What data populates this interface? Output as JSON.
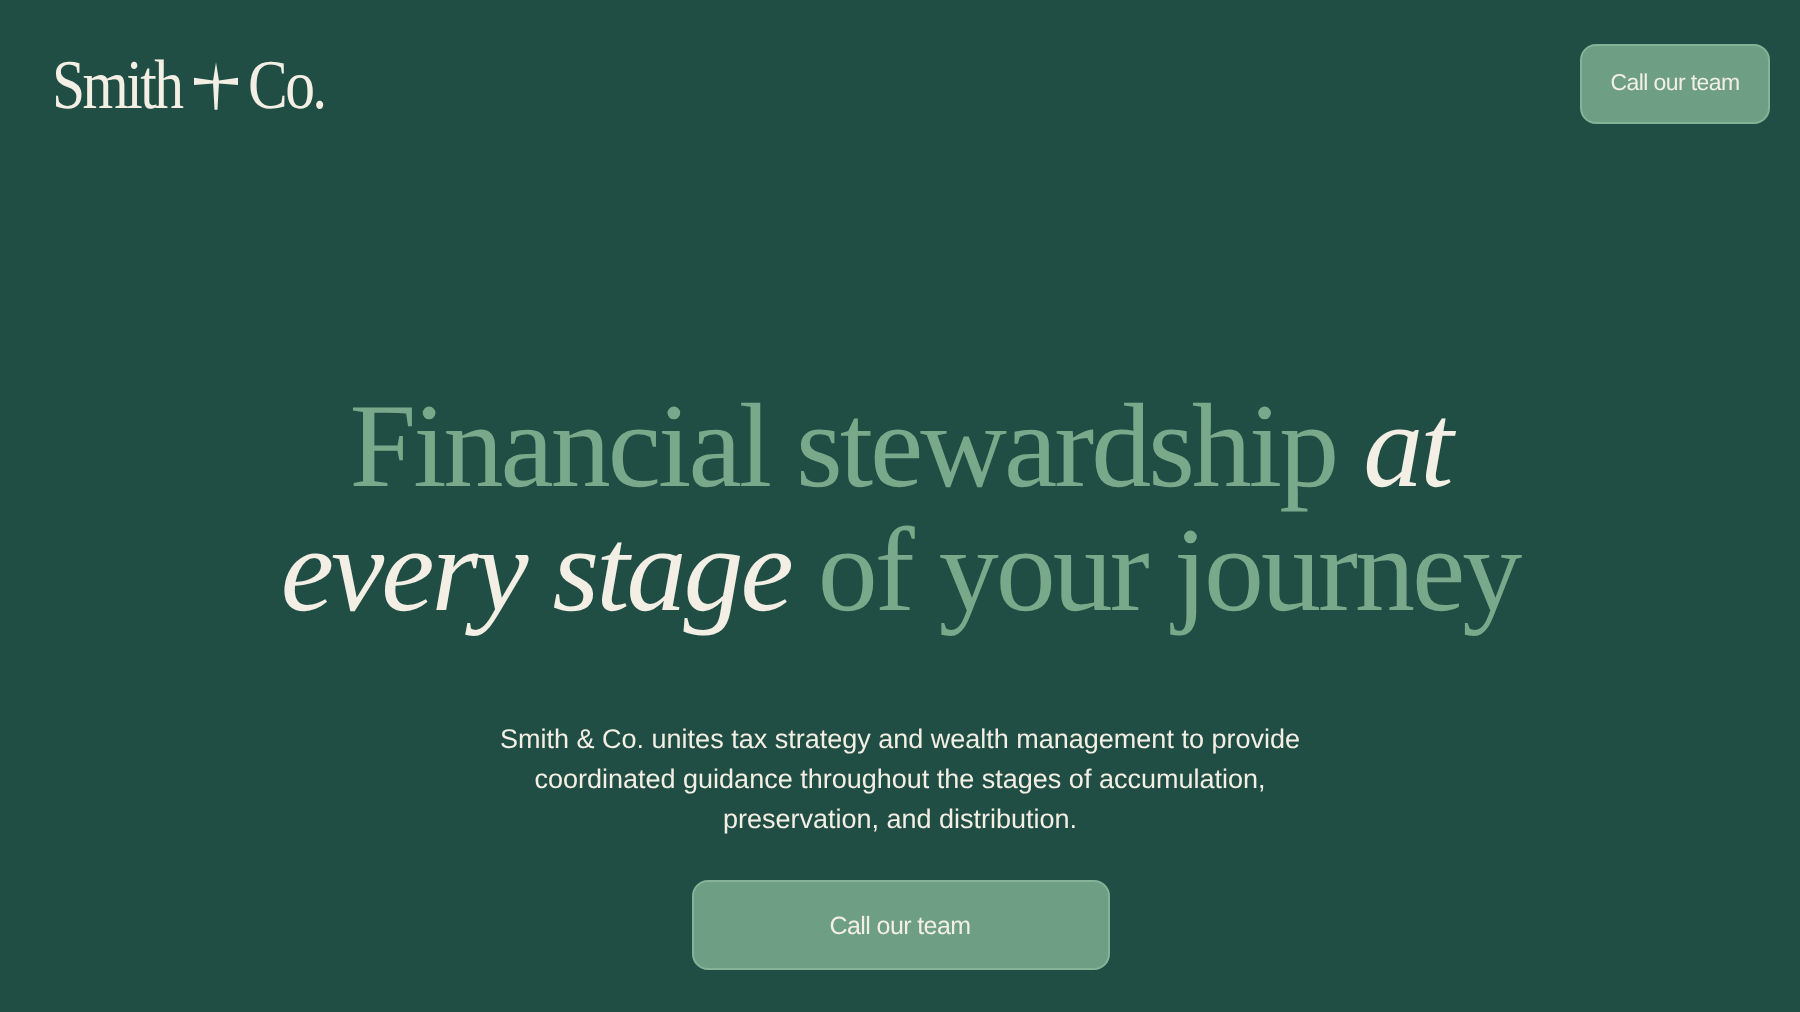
{
  "header": {
    "logo": {
      "word_1": "Smith",
      "word_2": "Co."
    },
    "button": "Call our team"
  },
  "hero": {
    "headline_line_1": "Financial stewardship *at*",
    "headline_line_2": "*every stage* of your journey",
    "description": "Smith & Co. unites tax strategy and wealth management to provide coordinated guidance throughout the stages of accumulation, preservation, and distribution.",
    "button": "Call our team"
  }
}
